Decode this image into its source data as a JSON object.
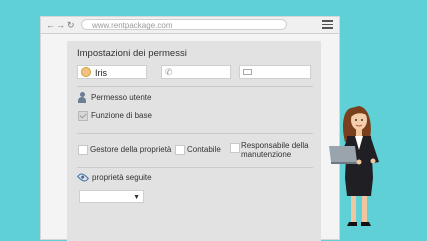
{
  "browser": {
    "nav_back": "←",
    "nav_forward": "→",
    "nav_reload": "↻",
    "url": "www.rentpackage.com"
  },
  "panel": {
    "title": "Impostazioni dei permessi",
    "name_value": "Iris",
    "user_permission": "Permesso utente",
    "base_function": "Funzione di base",
    "base_function_checked": true,
    "options": [
      {
        "label": "Gestore della proprietà",
        "checked": false
      },
      {
        "label": "Contabile",
        "checked": false
      },
      {
        "label": "Responsabile della manutenzione",
        "checked": false
      }
    ],
    "followed_properties": "proprietà seguite",
    "dropdown_arrow": "▼",
    "dropdown_value": ""
  },
  "colors": {
    "background": "#5fd0d6",
    "panel": "#e2e2e2",
    "accent": "#3a6ea5"
  }
}
